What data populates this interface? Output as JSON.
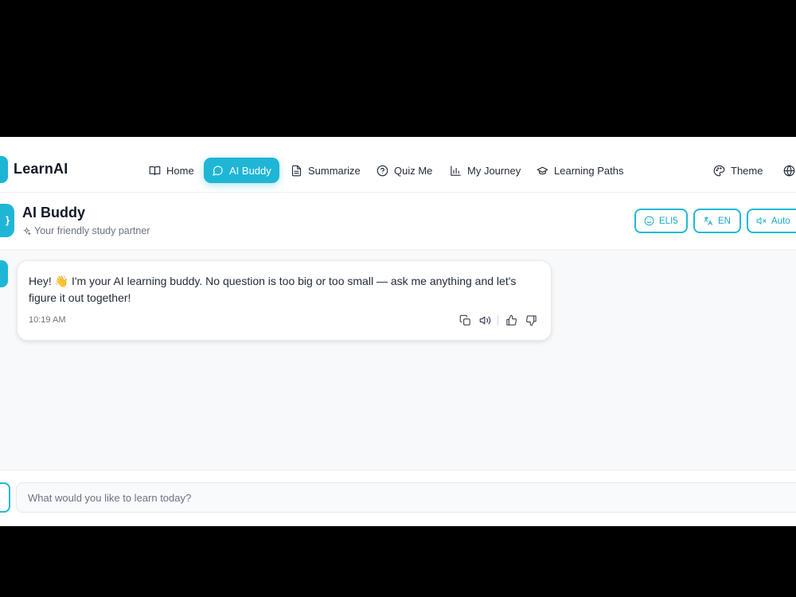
{
  "brand": {
    "name": "LearnAI"
  },
  "nav": {
    "items": [
      {
        "label": "Home",
        "icon": "book-icon"
      },
      {
        "label": "AI Buddy",
        "icon": "chat-bubble-icon",
        "active": true
      },
      {
        "label": "Summarize",
        "icon": "document-icon"
      },
      {
        "label": "Quiz Me",
        "icon": "help-circle-icon"
      },
      {
        "label": "My Journey",
        "icon": "bar-chart-icon"
      },
      {
        "label": "Learning Paths",
        "icon": "graduation-cap-icon"
      },
      {
        "label": "Theme",
        "icon": "palette-icon"
      }
    ],
    "language_icon": "globe-icon"
  },
  "header": {
    "title": "AI Buddy",
    "subtitle": "Your friendly study partner",
    "subtitle_icon": "sparkles-icon",
    "controls": [
      {
        "label": "ELI5",
        "icon": "smile-icon"
      },
      {
        "label": "EN",
        "icon": "translate-icon"
      },
      {
        "label": "Auto",
        "icon": "volume-mute-icon"
      }
    ]
  },
  "messages": [
    {
      "sender": "assistant",
      "text": "Hey! 👋 I'm your AI learning buddy. No question is too big or too small — ask me anything and let's figure it out together!",
      "time": "10:19 AM",
      "actions": [
        "copy-icon",
        "speaker-icon",
        "thumbs-up-icon",
        "thumbs-down-icon"
      ]
    }
  ],
  "composer": {
    "placeholder": "What would you like to learn today?",
    "value": ""
  },
  "colors": {
    "accent": "#1fb6d5",
    "page_bg": "#f8f9fb",
    "text": "#1f2937",
    "muted": "#6b7280"
  }
}
